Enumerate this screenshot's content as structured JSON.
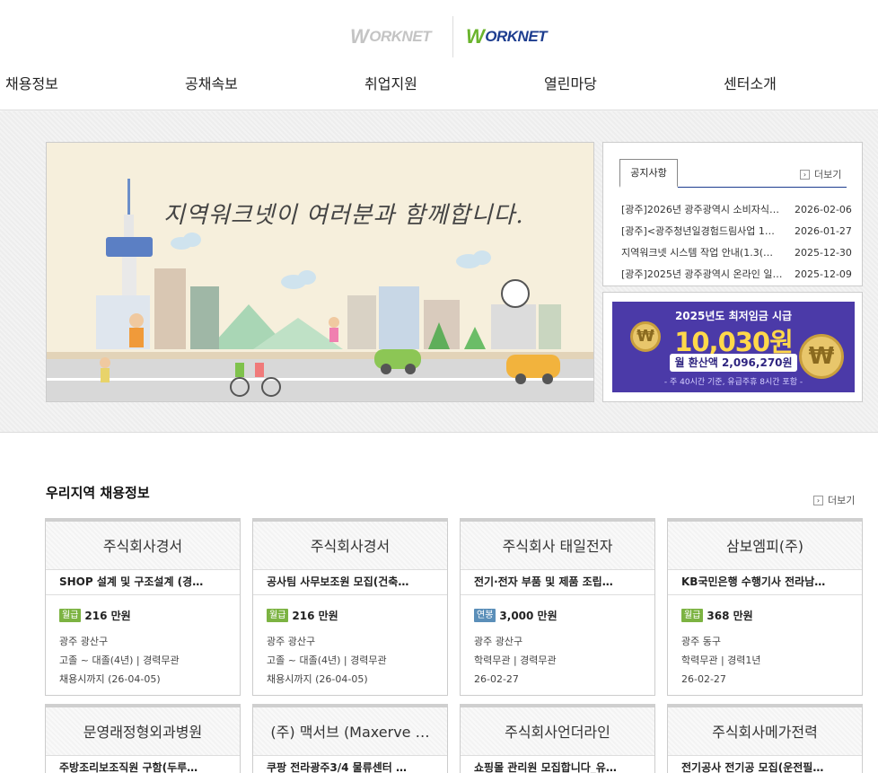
{
  "colors": {
    "brand_navy": "#1d3d8f",
    "brand_green": "#6ab42d",
    "monthly_badge": "#7cb342",
    "annual_badge": "#5b8fb9",
    "banner_purple": "#4b3aa8",
    "banner_yellow": "#ffd84a"
  },
  "header": {
    "logo_left": {
      "mark": "W",
      "text": "ORKNET"
    },
    "logo_right": {
      "mark": "W",
      "text": "ORKNET"
    },
    "nav": [
      "채용정보",
      "공채속보",
      "취업지원",
      "열린마당",
      "센터소개"
    ]
  },
  "hero": {
    "text": "지역워크넷이 여러분과 함께합니다."
  },
  "notice": {
    "tab_label": "공지사항",
    "more_label": "더보기",
    "more_icon": "chevron-right-icon",
    "items": [
      {
        "title": "[광주]2026년 광주광역시 소비자식…",
        "date": "2026-02-06"
      },
      {
        "title": "[광주]<광주청년일경험드림사업 1…",
        "date": "2026-01-27"
      },
      {
        "title": "지역워크넷 시스템 작업 안내(1.3(…",
        "date": "2025-12-30"
      },
      {
        "title": "[광주]2025년 광주광역시 온라인 일…",
        "date": "2025-12-09"
      }
    ]
  },
  "banner": {
    "line1": "2025년도 최저임금 시급",
    "line2": "10,030원",
    "line3": "월 환산액 2,096,270원",
    "line4": "- 주 40시간 기준, 유급주휴 8시간 포함 -",
    "coin_symbol": "₩"
  },
  "jobs": {
    "title": "우리지역 채용정보",
    "more_label": "더보기",
    "cards": [
      {
        "company": "주식회사경서",
        "job": "SHOP 설계 및 구조설계 (경…",
        "badge": "월급",
        "badge_type": "monthly",
        "salary": "216 만원",
        "location": "광주 광산구",
        "req": "고졸 ~ 대졸(4년) | 경력무관",
        "deadline": "채용시까지 (26-04-05)"
      },
      {
        "company": "주식회사경서",
        "job": "공사팀 사무보조원 모집(건축…",
        "badge": "월급",
        "badge_type": "monthly",
        "salary": "216 만원",
        "location": "광주 광산구",
        "req": "고졸 ~ 대졸(4년) | 경력무관",
        "deadline": "채용시까지 (26-04-05)"
      },
      {
        "company": "주식회사 태일전자",
        "job": "전기·전자 부품 및 제품 조립…",
        "badge": "연봉",
        "badge_type": "annual",
        "salary": "3,000 만원",
        "location": "광주 광산구",
        "req": "학력무관 | 경력무관",
        "deadline": "26-02-27"
      },
      {
        "company": "삼보엠피(주)",
        "job": "KB국민은행 수행기사 전라남…",
        "badge": "월급",
        "badge_type": "monthly",
        "salary": "368 만원",
        "location": "광주 동구",
        "req": "학력무관 | 경력1년",
        "deadline": "26-02-27"
      },
      {
        "company": "문영래정형외과병원",
        "job": "주방조리보조직원 구함(두루…",
        "badge": "",
        "salary": "",
        "location": "",
        "req": "",
        "deadline": ""
      },
      {
        "company": "(주) 맥서브 (Maxerve …",
        "job": "쿠팡 전라광주3/4 물류센터 …",
        "badge": "",
        "salary": "",
        "location": "",
        "req": "",
        "deadline": ""
      },
      {
        "company": "주식회사언더라인",
        "job": "쇼핑몰 관리원 모집합니다_유…",
        "badge": "",
        "salary": "",
        "location": "",
        "req": "",
        "deadline": ""
      },
      {
        "company": "주식회사메가전력",
        "job": "전기공사 전기공 모집(운전필…",
        "badge": "",
        "salary": "",
        "location": "",
        "req": "",
        "deadline": ""
      }
    ]
  }
}
